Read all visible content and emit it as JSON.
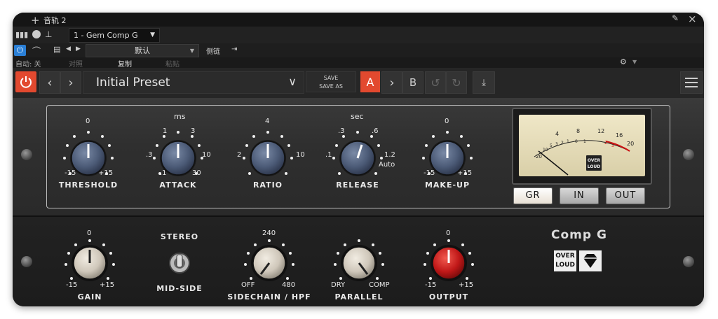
{
  "titlebar": {
    "title": "音轨 2",
    "add_icon": "plus-icon",
    "pin_icon": "pin-icon",
    "close_icon": "close-icon"
  },
  "daw": {
    "plugin_select": "1 - Gem Comp G",
    "preset_default": "默认",
    "sidechain": "侧链",
    "auto_label": "自动: 关",
    "compare": "对照",
    "copy": "复制",
    "paste": "粘贴"
  },
  "plugin": {
    "preset_name": "Initial Preset",
    "save": "SAVE",
    "save_as": "SAVE AS",
    "ab_a": "A",
    "ab_b": "B",
    "accent": "#e2492f"
  },
  "top_section": {
    "attack_unit": "ms",
    "release_unit": "sec",
    "knobs": [
      {
        "id": "threshold",
        "label": "THRESHOLD",
        "ticks": [
          "0",
          "-15",
          "+15"
        ]
      },
      {
        "id": "attack",
        "label": "ATTACK",
        "ticks": [
          "1",
          "3",
          ".3",
          "10",
          ".1",
          "30"
        ]
      },
      {
        "id": "ratio",
        "label": "RATIO",
        "ticks": [
          "4",
          "2",
          "10"
        ]
      },
      {
        "id": "release",
        "label": "RELEASE",
        "ticks": [
          ".3",
          ".6",
          ".1",
          "1.2",
          "Auto"
        ]
      },
      {
        "id": "makeup",
        "label": "MAKE-UP",
        "ticks": [
          "0",
          "-15",
          "+15"
        ]
      }
    ],
    "vu": {
      "scale": [
        "20",
        "10",
        "5",
        "3",
        "2",
        "1",
        "0",
        "1",
        "2",
        "3",
        "4",
        "8",
        "12",
        "16",
        "20"
      ],
      "logo_line1": "OVER",
      "logo_line2": "LOUD",
      "needle_level": -20
    },
    "meter_buttons": [
      "GR",
      "IN",
      "OUT"
    ],
    "meter_selected": "GR"
  },
  "bottom_section": {
    "knobs": [
      {
        "id": "gain",
        "label": "GAIN",
        "ticks": [
          "0",
          "-15",
          "+15"
        ]
      },
      {
        "id": "sidechain_hpf",
        "label": "SIDECHAIN / HPF",
        "ticks": [
          "240",
          "OFF",
          "480"
        ]
      },
      {
        "id": "parallel",
        "label": "PARALLEL",
        "ticks": [
          "DRY",
          "COMP"
        ]
      },
      {
        "id": "output",
        "label": "OUTPUT",
        "ticks": [
          "0",
          "-15",
          "+15"
        ]
      }
    ],
    "switch": {
      "top": "STEREO",
      "bottom": "MID-SIDE"
    },
    "brand": {
      "title": "Comp G",
      "logo_line1": "OVER",
      "logo_line2": "LOUD"
    }
  }
}
